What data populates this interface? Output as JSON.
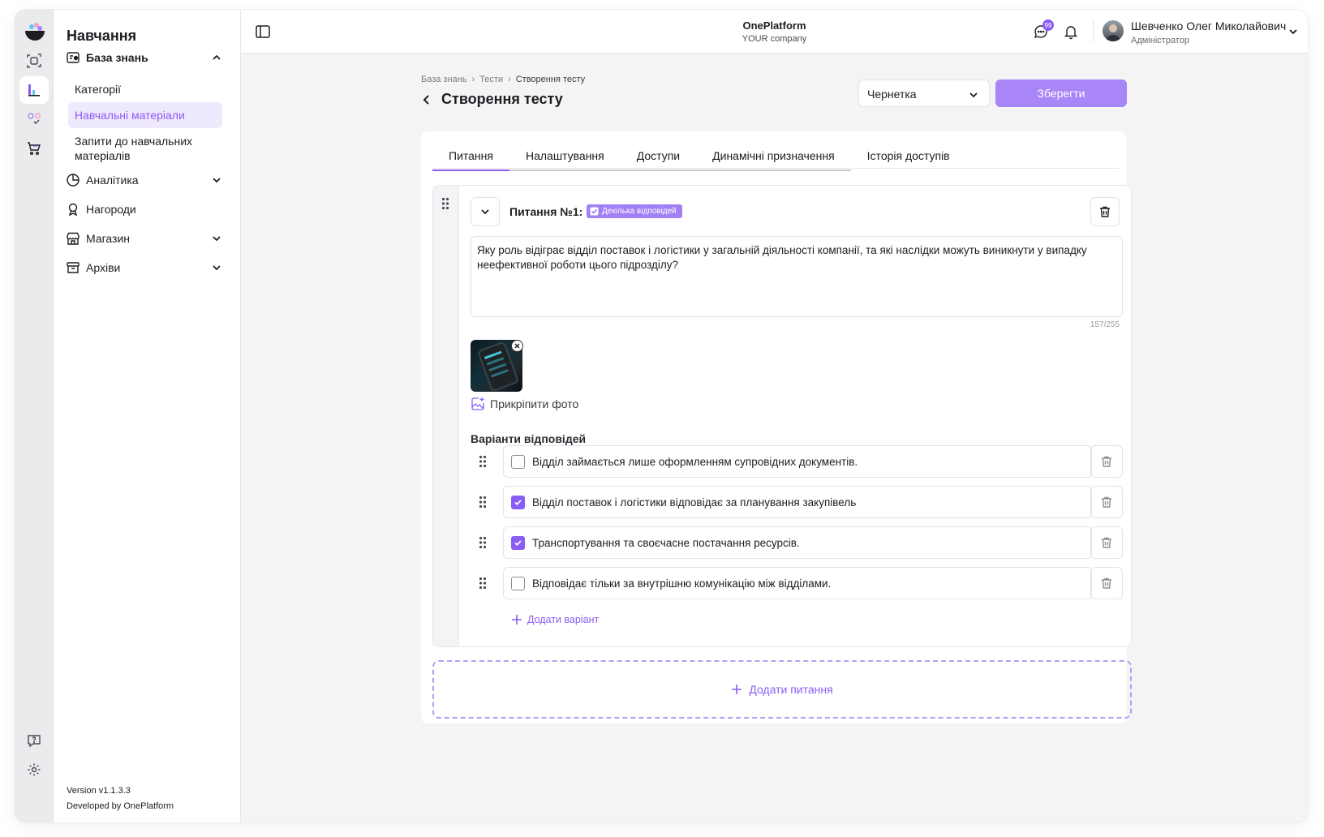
{
  "sidebar": {
    "title": "Навчання",
    "section": "База знань",
    "sub_items": [
      {
        "label": "Категорії"
      },
      {
        "label": "Навчальні матеріали"
      },
      {
        "label": "Запити до навчальних матеріалів"
      }
    ],
    "items": [
      {
        "label": "Аналітика"
      },
      {
        "label": "Нагороди"
      },
      {
        "label": "Магазин"
      },
      {
        "label": "Архіви"
      }
    ],
    "version": "Version v1.1.3.3",
    "developer": "Developed by OnePlatform"
  },
  "header": {
    "app_name": "OnePlatform",
    "company": "YOUR company",
    "chat_badge": "99",
    "user_name": "Шевченко Олег Миколайович",
    "user_role": "Адміністратор"
  },
  "page": {
    "breadcrumbs": [
      "База знань",
      "Тести",
      "Створення тесту"
    ],
    "title": "Створення тесту",
    "status": "Чернетка",
    "save_label": "Зберегти"
  },
  "tabs": [
    {
      "label": "Питання",
      "active": true
    },
    {
      "label": "Налаштування"
    },
    {
      "label": "Доступи"
    },
    {
      "label": "Динамічні призначення"
    },
    {
      "label": "Історія доступів"
    }
  ],
  "question": {
    "title": "Питання №1:",
    "tag": "Декілька відповідей",
    "text": "Яку роль відіграє відділ поставок і логістики у загальній діяльності компанії, та які наслідки можуть виникнути у випадку неефективної роботи цього підрозділу?",
    "counter": "157/255",
    "attach_label": "Прикріпити фото",
    "answers_label": "Варіанти відповідей",
    "answers": [
      {
        "text": "Відділ займається лише оформленням супровідних документів.",
        "checked": false
      },
      {
        "text": "Відділ поставок і логістики відповідає за планування закупівель",
        "checked": true
      },
      {
        "text": "Транспортування та своєчасне постачання ресурсів.",
        "checked": true
      },
      {
        "text": "Відповідає тільки за внутрішню комунікацію між відділами.",
        "checked": false
      }
    ],
    "add_variant": "Додати варіант"
  },
  "add_question": "Додати питання",
  "colors": {
    "accent": "#8a5cf6",
    "accent_button": "#a886f7",
    "accent_light": "#efe9fd"
  }
}
